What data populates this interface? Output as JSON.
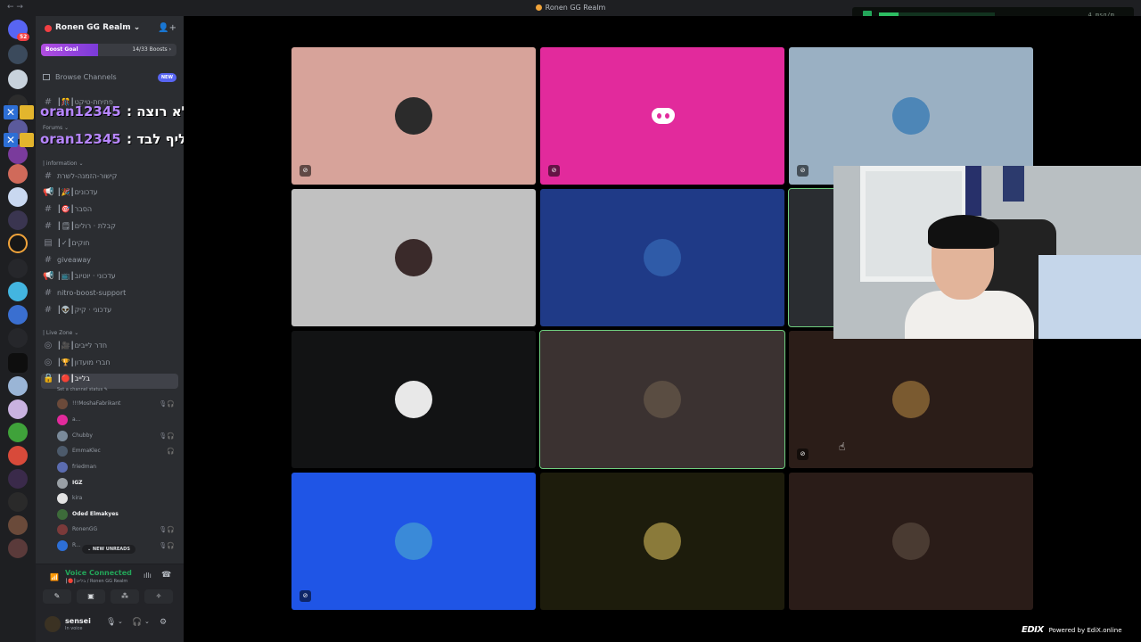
{
  "titlebar": {
    "title": "Ronen GG Realm",
    "nav": "← →"
  },
  "overlay_widget": {
    "readout": "4 msg/m"
  },
  "servers": {
    "badge": "52"
  },
  "guild": {
    "name": "Ronen GG Realm ⌄",
    "invite_icon": "👤+"
  },
  "boost": {
    "goal_label": "Boost Goal",
    "count_label": "14/33 Boosts ›"
  },
  "browse": {
    "label": "Browse Channels",
    "badge": "NEW"
  },
  "channels": [
    {
      "label": "┃🎊┃פתיחת-טיקט",
      "icon": "#"
    },
    {
      "label": "Forums ⌄",
      "icon": ""
    },
    {
      "label": "| information ⌄",
      "icon": ""
    },
    {
      "label": "קישור-הזמנה-לשרת",
      "icon": "#"
    },
    {
      "label": "┃🎉┃עדכונים",
      "icon": "📢"
    },
    {
      "label": "┃🎯┃הסבר",
      "icon": "#"
    },
    {
      "label": "┃🗒┃קבלת · רולים",
      "icon": "#"
    },
    {
      "label": "┃✓┃חוקים",
      "icon": "▤"
    },
    {
      "label": "giveaway",
      "icon": "#"
    },
    {
      "label": "┃📺┃עדכוני · יוטיוב",
      "icon": "📢"
    },
    {
      "label": "nitro-boost-support",
      "icon": "#"
    },
    {
      "label": "┃👽┃עדכוני · קיק",
      "icon": "#"
    },
    {
      "label": "| Live Zone ⌄",
      "icon": ""
    },
    {
      "label": "┃🎥┃חדר לייבים",
      "icon": "◎"
    },
    {
      "label": "┃🏆┃חברי מועדון",
      "icon": "◎"
    },
    {
      "label": "┃🔴┃בלייב",
      "icon": "🔒"
    }
  ],
  "set_status": "Set a channel status ✎",
  "voice_users": [
    {
      "name": "!!!MoshaFabrikant",
      "icons": "🎙🎧",
      "color": "#6b4a3a",
      "bright": false
    },
    {
      "name": "a...",
      "icons": "",
      "color": "#e22a9c",
      "bright": false
    },
    {
      "name": "Chubby",
      "icons": "🎙🎧",
      "color": "#7a8a9a",
      "bright": false
    },
    {
      "name": "EmmaKlec",
      "icons": "🎧",
      "color": "#4c5a6b",
      "bright": false
    },
    {
      "name": "friedman",
      "icons": "",
      "color": "#5b6cb0",
      "bright": false
    },
    {
      "name": "IGZ",
      "icons": "",
      "color": "#9aa0a6",
      "bright": true
    },
    {
      "name": "kira",
      "icons": "",
      "color": "#e3e3e3",
      "bright": false
    },
    {
      "name": "Oded Elmakyes",
      "icons": "",
      "color": "#3d6b3a",
      "bright": true
    },
    {
      "name": "RonenGG",
      "icons": "🎙🎧",
      "color": "#7b3a3a",
      "bright": false
    },
    {
      "name": "R...",
      "icons": "🎙🎧",
      "color": "#2d6fd6",
      "bright": false
    }
  ],
  "unreads": "⌄ NEW UNREADS",
  "rtc": {
    "status": "Voice Connected",
    "channel": "┃🔴┃בלייב / Ronen GG Realm",
    "buttons": [
      "✎",
      "▣",
      "⁂",
      "✧"
    ]
  },
  "user": {
    "name": "sensei",
    "status": "In voice",
    "controls": [
      "🎙",
      "⌄",
      "🎧",
      "⌄",
      "⚙"
    ]
  },
  "overlay_chat": [
    {
      "user": "oran12345",
      "message": ": לא רוצה"
    },
    {
      "user": "oran12345",
      "message": ": תחליף לבד"
    }
  ],
  "tiles": [
    {
      "bg": "#d7a39a",
      "avatar": "#2b2b2b",
      "mic": "⊘",
      "kind": "avatar"
    },
    {
      "bg": "#e22a9c",
      "avatar": "",
      "mic": "⊘",
      "kind": "discord"
    },
    {
      "bg": "#9ab0c3",
      "avatar": "#4d86b7",
      "mic": "⊘",
      "kind": "avatar"
    },
    {
      "bg": "#c1c1c1",
      "avatar": "#3a2a2a",
      "mic": "",
      "kind": "avatar"
    },
    {
      "bg": "#1f3a87",
      "avatar": "#2f5ba8",
      "mic": "",
      "kind": "avatar"
    },
    {
      "bg": "#2a2d31",
      "avatar": "",
      "mic": "",
      "kind": "empty",
      "speaking": true
    },
    {
      "bg": "#121314",
      "avatar": "#e8e8e8",
      "mic": "",
      "kind": "avatar"
    },
    {
      "bg": "#3b3231",
      "avatar": "#5a4d42",
      "mic": "",
      "kind": "avatar",
      "speaking": true
    },
    {
      "bg": "#2b1d18",
      "avatar": "#7a5a30",
      "mic": "⊘",
      "kind": "avatar"
    },
    {
      "bg": "#1f55e6",
      "avatar": "#3a8ad8",
      "mic": "⊘",
      "kind": "avatar"
    },
    {
      "bg": "#1d1c0c",
      "avatar": "#8a7a3a",
      "mic": "",
      "kind": "avatar"
    },
    {
      "bg": "#2a1c18",
      "avatar": "#4a3b32",
      "mic": "",
      "kind": "avatar"
    }
  ],
  "brand": {
    "logo": "EDIX",
    "text": "Powered by EdiX.online"
  }
}
